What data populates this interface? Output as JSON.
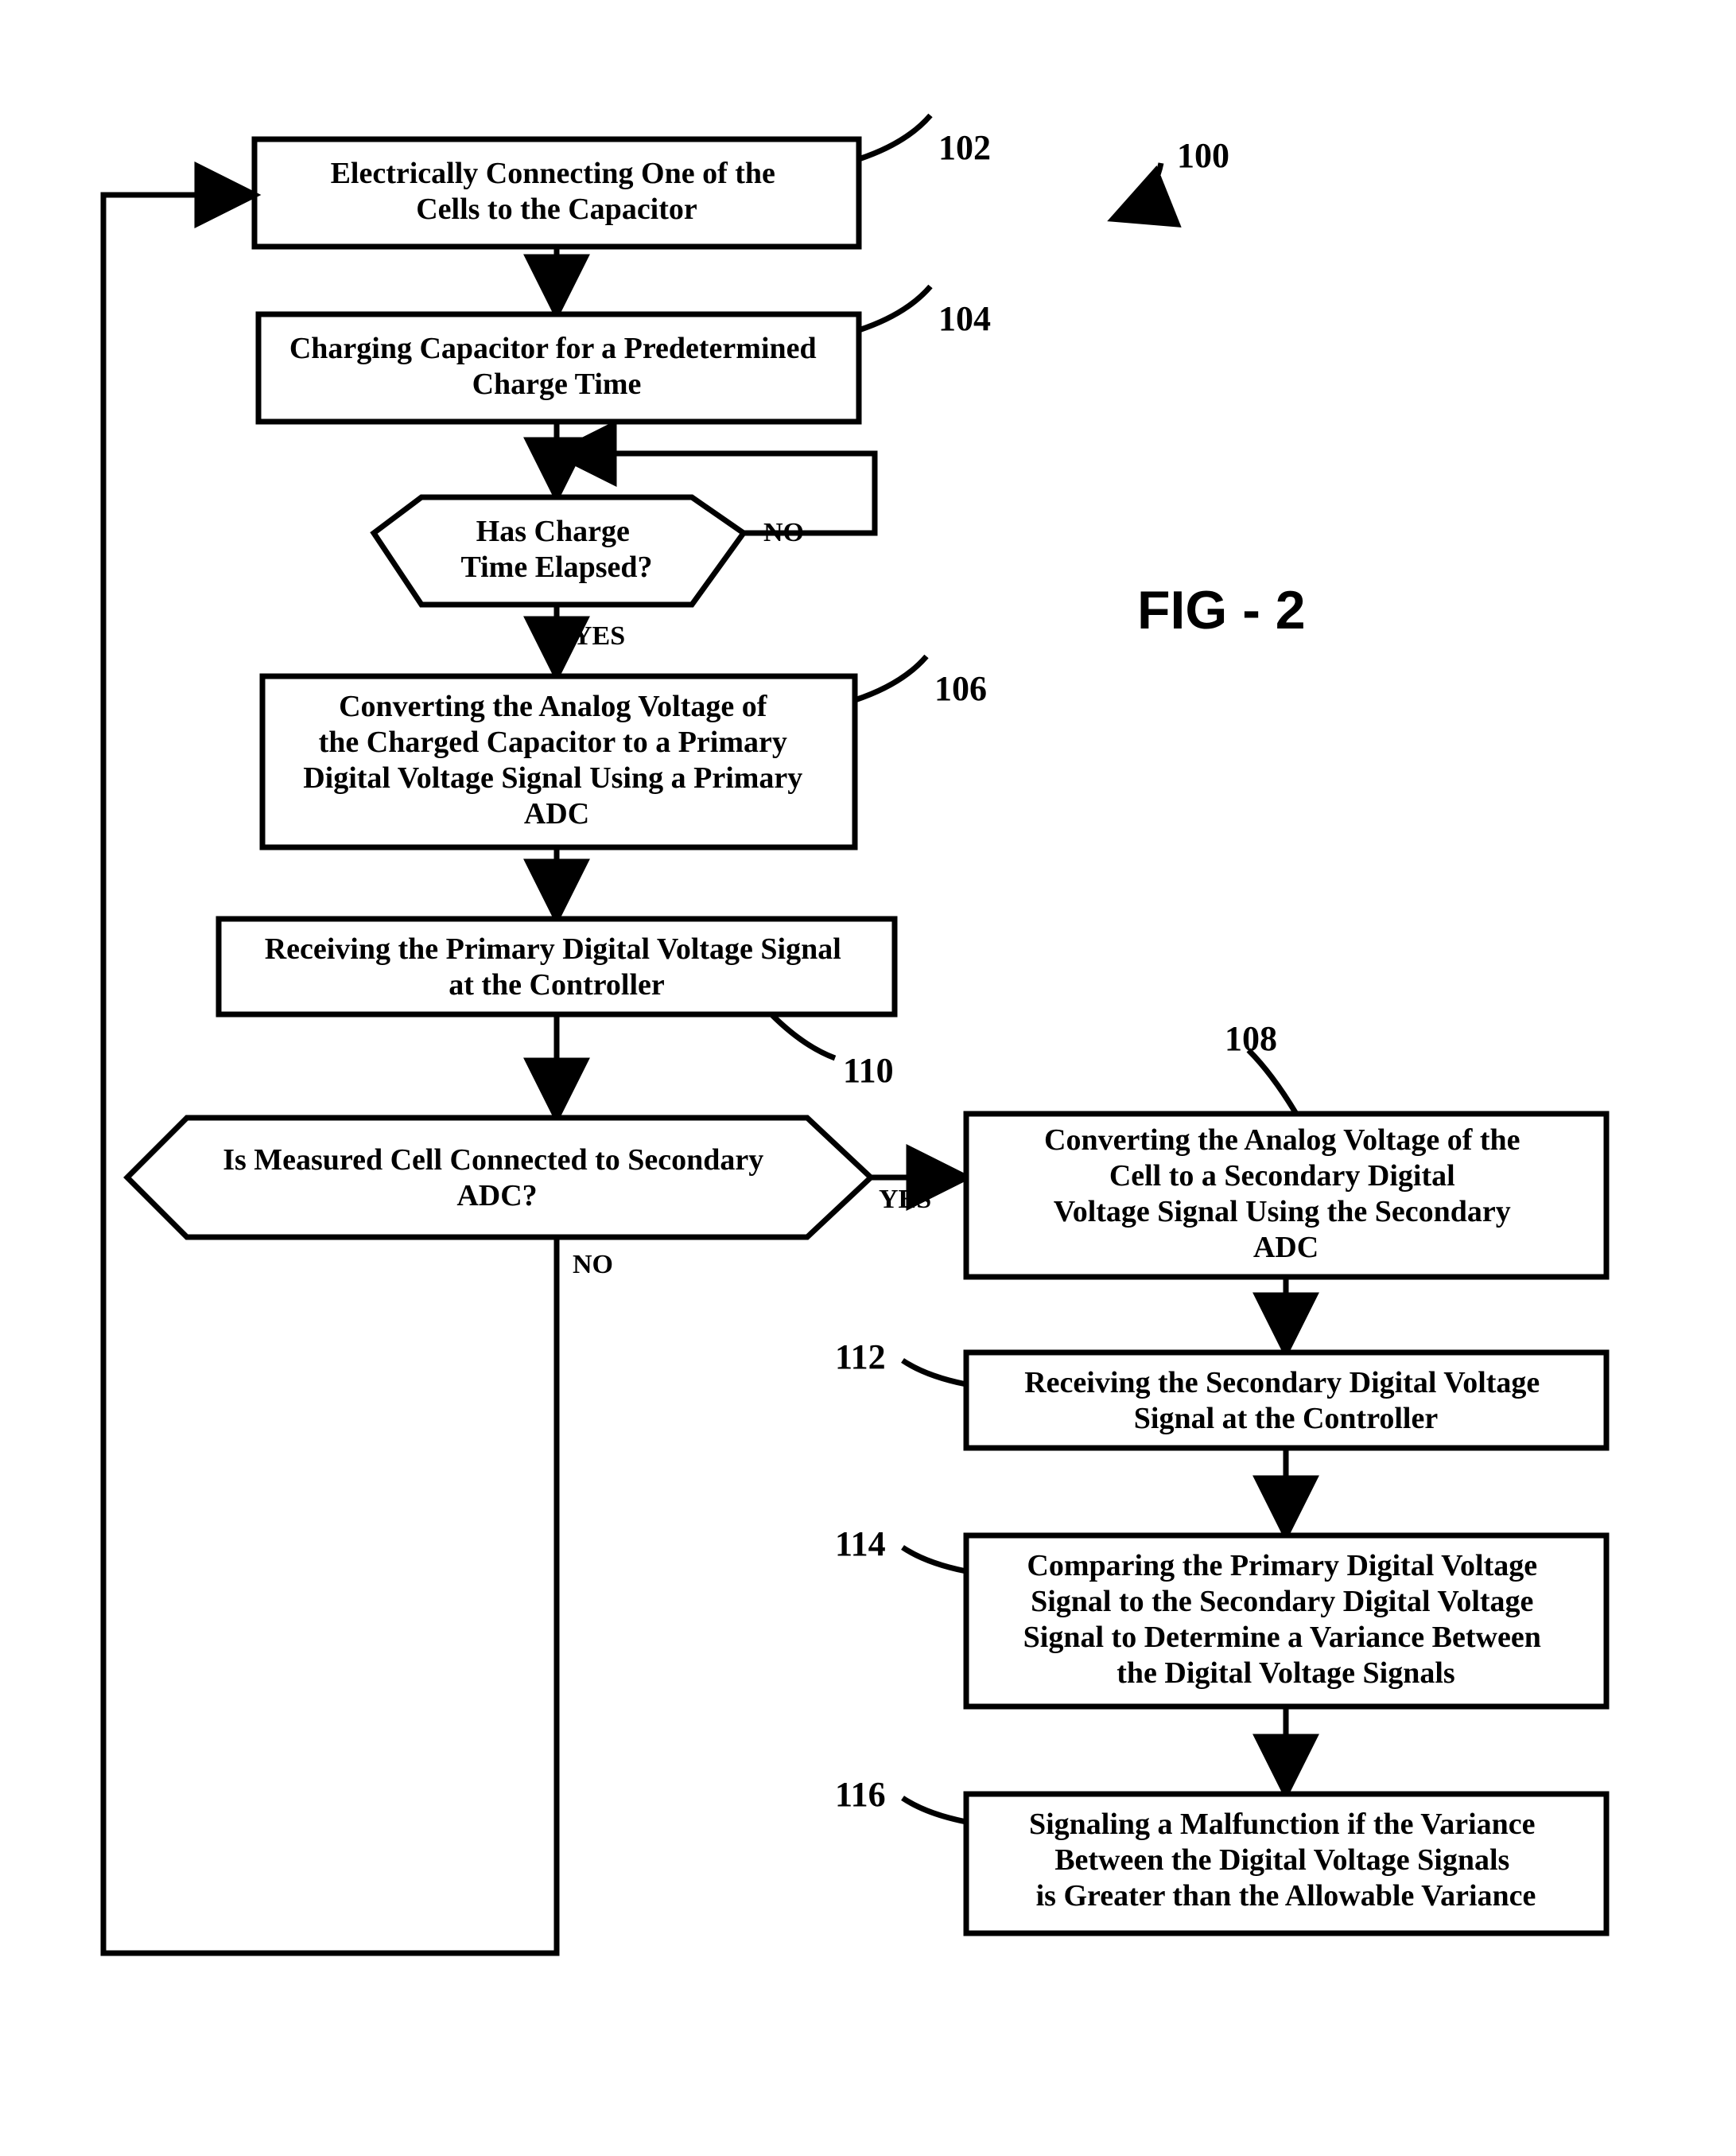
{
  "figure_label": "FIG - 2",
  "reference_100": "100",
  "steps": {
    "s102": {
      "ref": "102",
      "lines": [
        "Electrically Connecting One of the",
        "Cells to the Capacitor"
      ]
    },
    "s104": {
      "ref": "104",
      "lines": [
        "Charging Capacitor for a Predetermined",
        "Charge Time"
      ]
    },
    "d104a": {
      "lines": [
        "Has Charge",
        "Time Elapsed?"
      ],
      "yes": "YES",
      "no": "NO"
    },
    "s106": {
      "ref": "106",
      "lines": [
        "Converting the Analog Voltage of",
        "the Charged Capacitor to a Primary",
        "Digital Voltage Signal Using a Primary",
        "ADC"
      ]
    },
    "s110": {
      "ref": "110",
      "lines": [
        "Receiving the Primary Digital Voltage Signal",
        "at the Controller"
      ]
    },
    "d110a": {
      "lines": [
        "Is Measured Cell Connected to Secondary",
        "ADC?"
      ],
      "yes": "YES",
      "no": "NO"
    },
    "s108": {
      "ref": "108",
      "lines": [
        "Converting the Analog Voltage of the",
        "Cell to a Secondary Digital",
        "Voltage Signal Using the Secondary",
        "ADC"
      ]
    },
    "s112": {
      "ref": "112",
      "lines": [
        "Receiving the Secondary Digital Voltage",
        "Signal at the Controller"
      ]
    },
    "s114": {
      "ref": "114",
      "lines": [
        "Comparing the Primary Digital Voltage",
        "Signal to the Secondary Digital Voltage",
        "Signal to Determine a Variance Between",
        "the Digital Voltage Signals"
      ]
    },
    "s116": {
      "ref": "116",
      "lines": [
        "Signaling a Malfunction if the Variance",
        "Between the Digital Voltage Signals",
        "is Greater than the Allowable Variance"
      ]
    }
  }
}
